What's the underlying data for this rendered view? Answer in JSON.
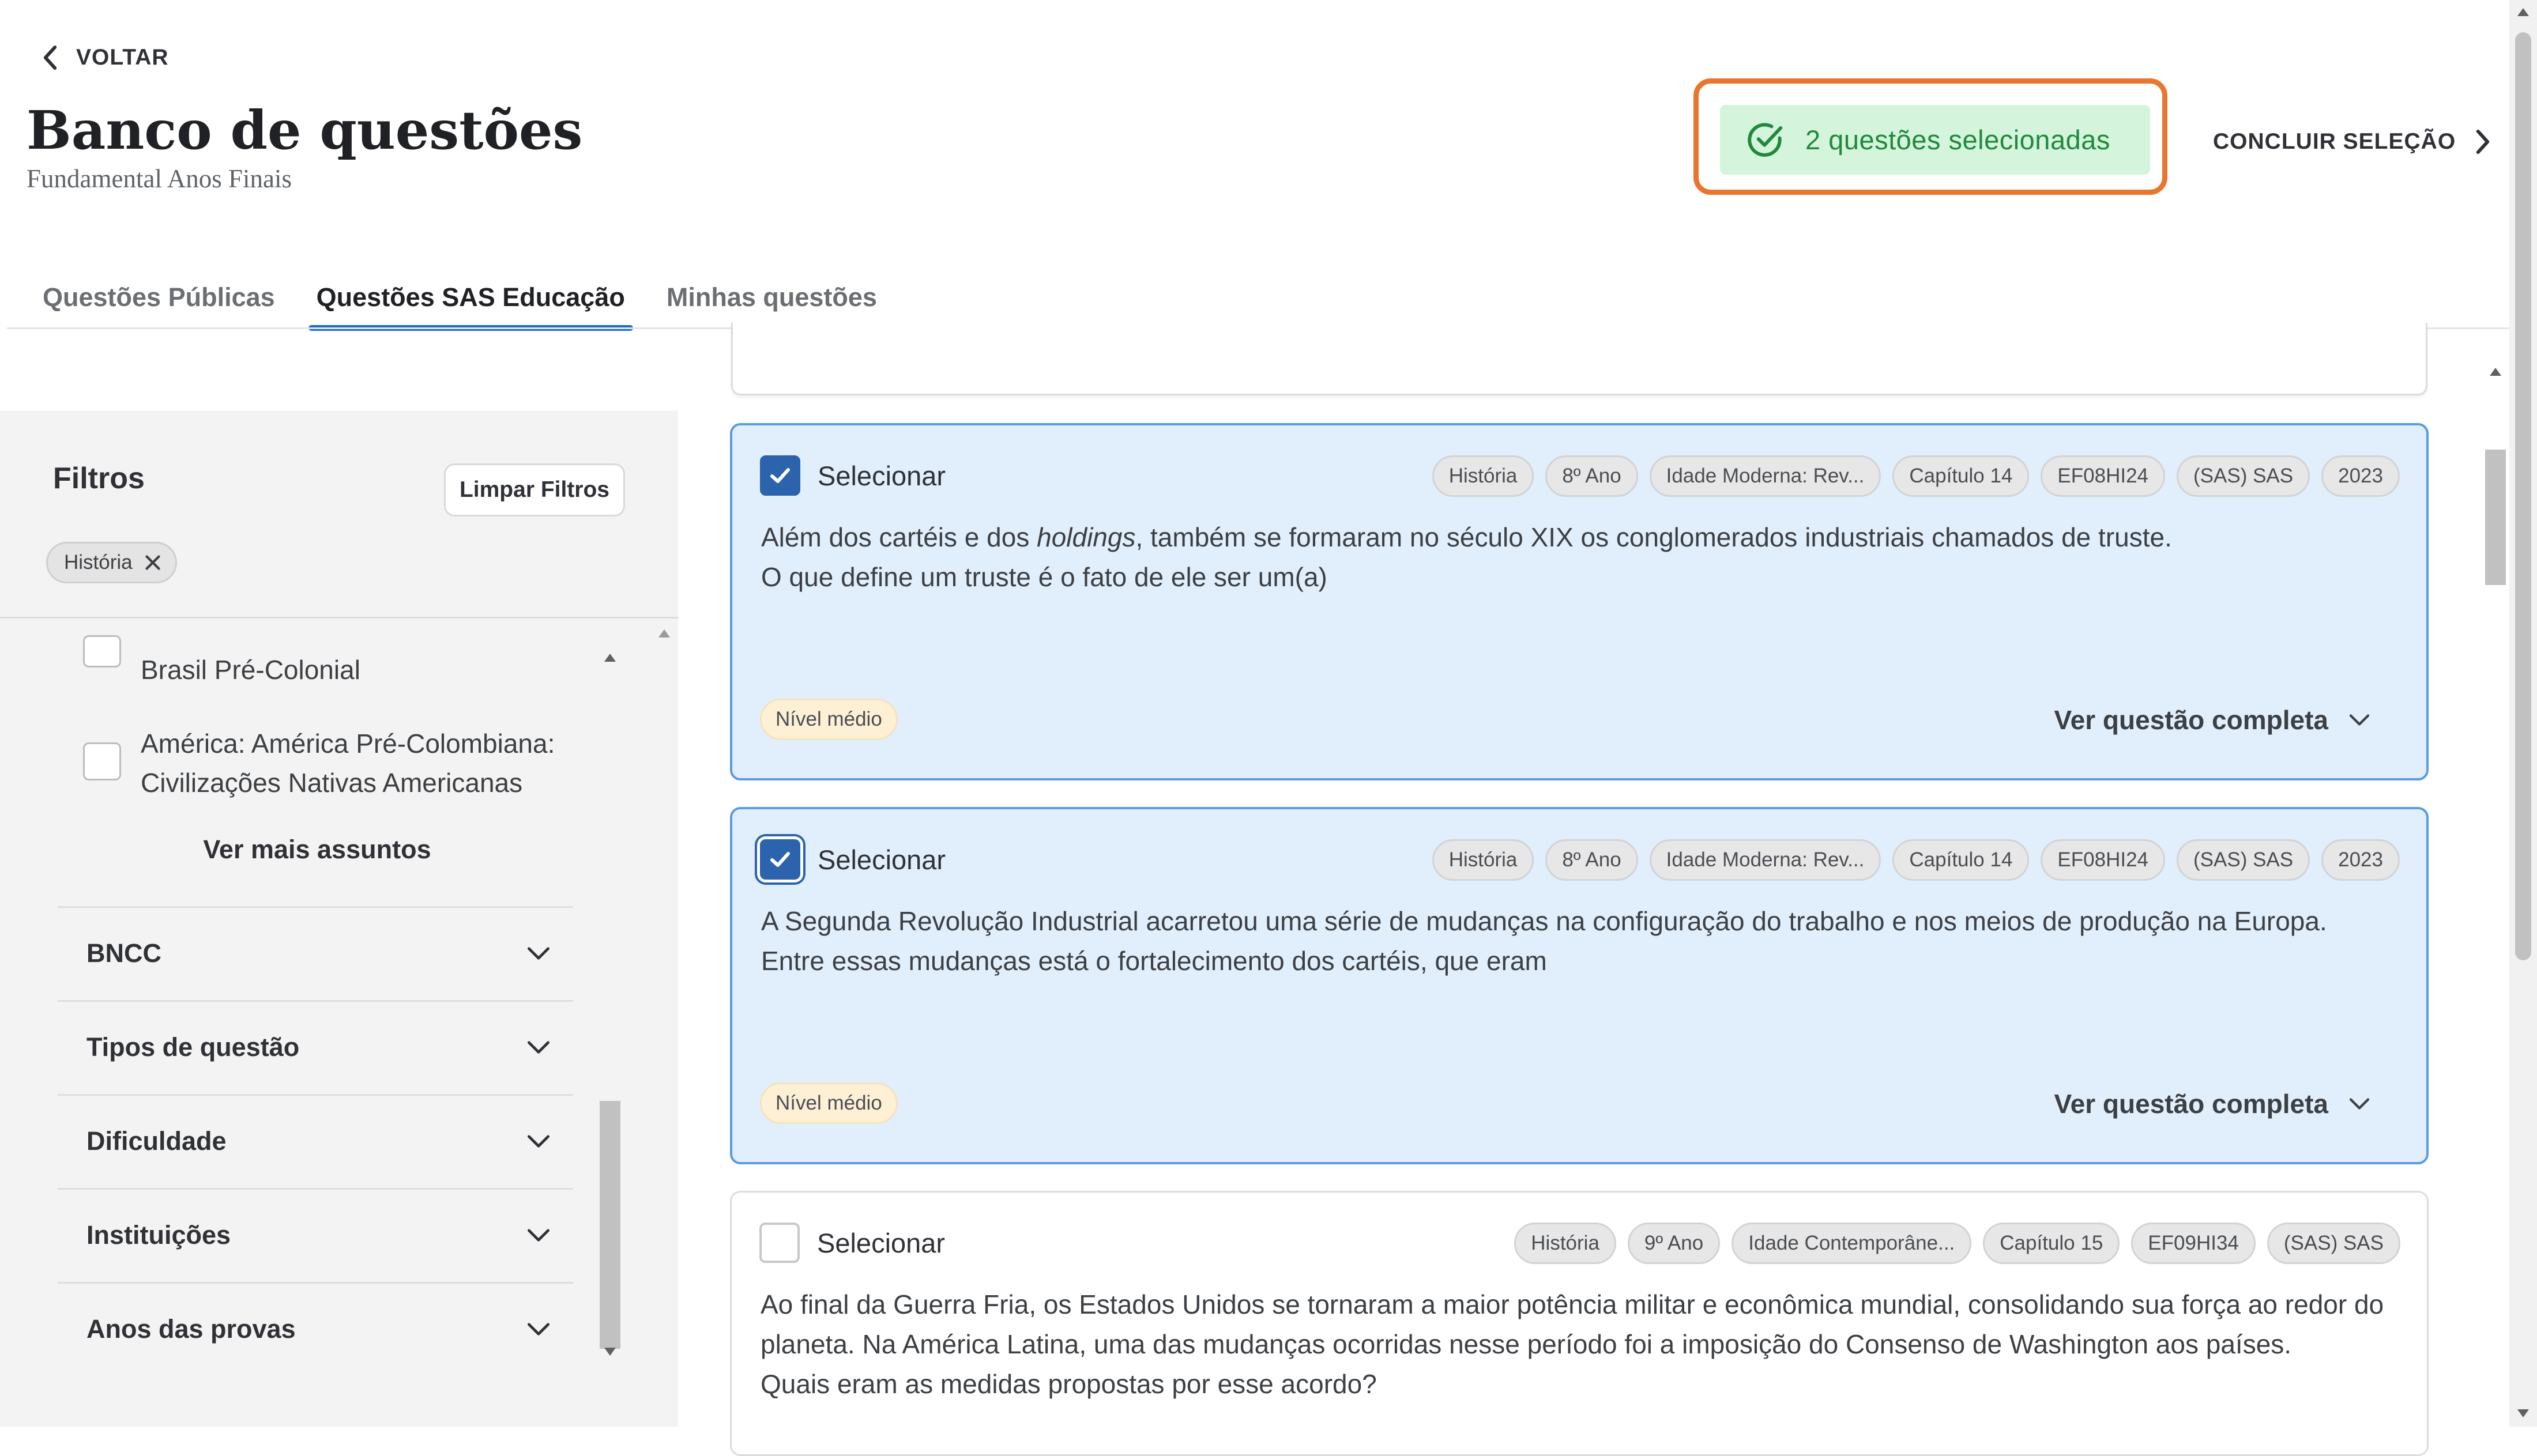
{
  "header": {
    "back_label": "VOLTAR",
    "title": "Banco de questões",
    "subtitle": "Fundamental Anos Finais",
    "selected_count_text": "2 questões selecionadas",
    "conclude_label": "CONCLUIR SELEÇÃO"
  },
  "tabs": [
    {
      "label": "Questões Públicas",
      "active": false
    },
    {
      "label": "Questões SAS Educação",
      "active": true
    },
    {
      "label": "Minhas questões",
      "active": false
    }
  ],
  "filters": {
    "title": "Filtros",
    "clear_label": "Limpar Filtros",
    "active_chip": "História",
    "subjects": [
      {
        "label": "Brasil Pré-Colonial",
        "checked": false
      },
      {
        "label": "América: América Pré-Colombiana: Civilizações Nativas Americanas",
        "checked": false
      }
    ],
    "see_more": "Ver mais assuntos",
    "sections": [
      "BNCC",
      "Tipos de questão",
      "Dificuldade",
      "Instituições",
      "Anos das provas"
    ]
  },
  "questions": [
    {
      "selected": true,
      "select_label": "Selecionar",
      "tags": [
        "História",
        "8º Ano",
        "Idade Moderna: Rev...",
        "Capítulo 14",
        "EF08HI24",
        "(SAS) SAS",
        "2023"
      ],
      "text_lines": [
        [
          "Além dos cartéis e dos ",
          "holdings",
          ", também se formaram no século XIX os conglomerados industriais chamados de truste."
        ],
        "O que define um truste é o fato de ele ser um(a)"
      ],
      "level": "Nível médio",
      "see_full": "Ver questão completa"
    },
    {
      "selected": true,
      "select_label": "Selecionar",
      "tags": [
        "História",
        "8º Ano",
        "Idade Moderna: Rev...",
        "Capítulo 14",
        "EF08HI24",
        "(SAS) SAS",
        "2023"
      ],
      "text_lines": [
        "A Segunda Revolução Industrial acarretou uma série de mudanças na configuração do trabalho e nos meios de produção na Europa.",
        "Entre essas mudanças está o fortalecimento dos cartéis, que eram"
      ],
      "level": "Nível médio",
      "see_full": "Ver questão completa"
    },
    {
      "selected": false,
      "select_label": "Selecionar",
      "tags": [
        "História",
        "9º Ano",
        "Idade Contemporâne...",
        "Capítulo 15",
        "EF09HI34",
        "(SAS) SAS"
      ],
      "text_lines": [
        "Ao final da Guerra Fria, os Estados Unidos se tornaram a maior potência militar e econômica mundial, consolidando sua força ao redor do",
        "planeta. Na América Latina, uma das mudanças ocorridas nesse período foi a imposição do Consenso de Washington aos países.",
        "Quais eram as medidas propostas por esse acordo?"
      ]
    }
  ],
  "colors": {
    "accent_blue": "#2c63ad",
    "tab_underline": "#1a6ad6",
    "selected_card_bg": "#e1effc",
    "selected_card_border": "#5c9ae2",
    "success_green": "#1f8a3c",
    "success_bg": "#d4f4dc",
    "highlight_orange": "#e8762e",
    "level_bg": "#fdf0d5"
  },
  "icons": {
    "back": "chevron-left-icon",
    "conclude": "chevron-right-icon",
    "selected_badge": "check-circle-icon",
    "remove_chip": "close-icon",
    "expand": "chevron-down-icon",
    "checkbox": "check-icon"
  }
}
